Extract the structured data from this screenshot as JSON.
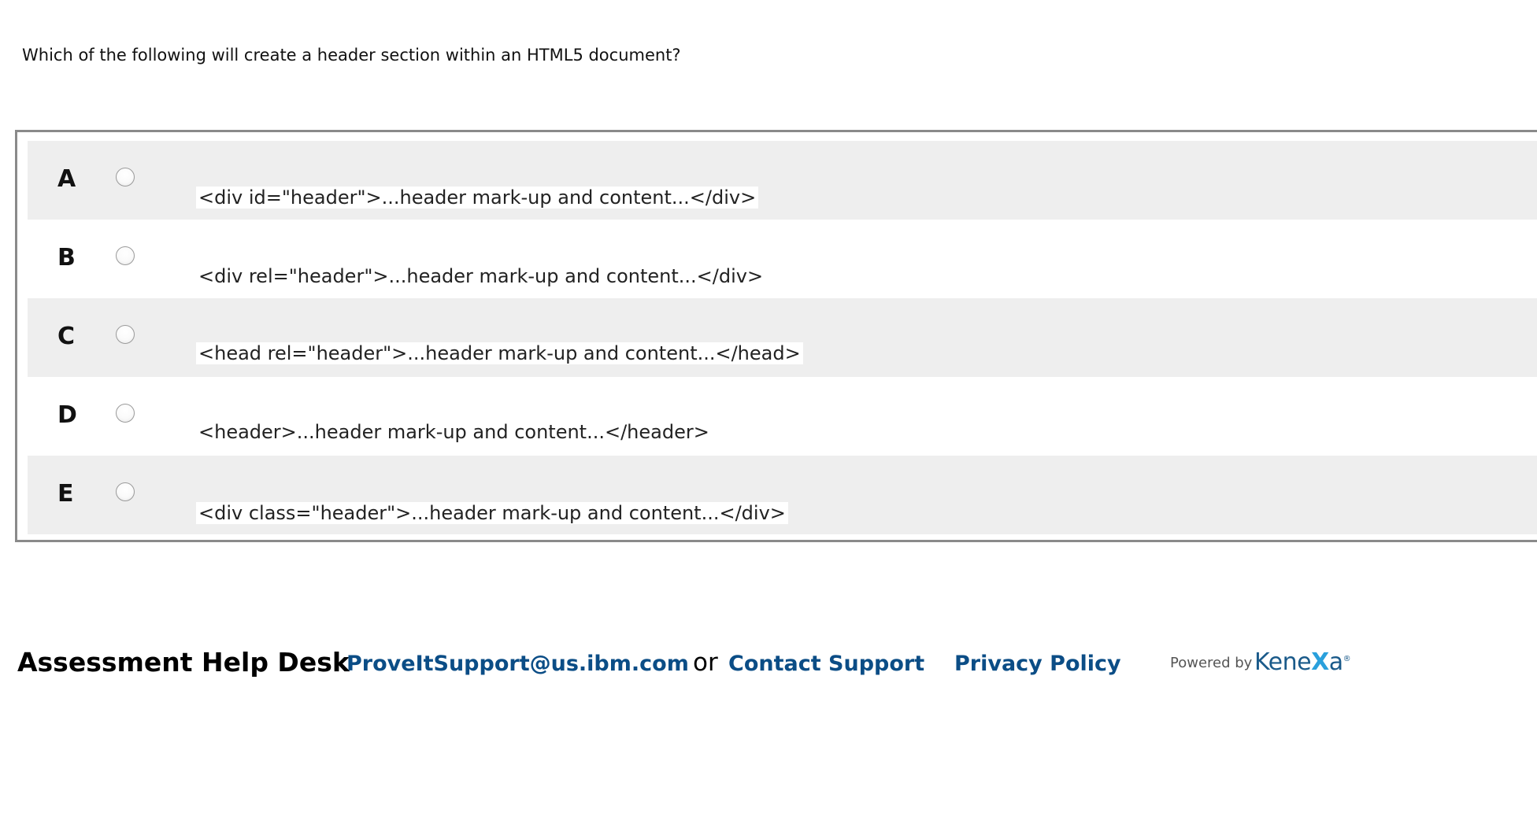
{
  "question": {
    "text": "Which of the following will create a header section within an HTML5 document?"
  },
  "options": [
    {
      "letter": "A",
      "text": "<div id=\"header\">...header mark-up and content...</div>"
    },
    {
      "letter": "B",
      "text": "<div rel=\"header\">...header mark-up and content...</div>"
    },
    {
      "letter": "C",
      "text": "<head rel=\"header\">...header mark-up and content...</head>"
    },
    {
      "letter": "D",
      "text": "<header>...header mark-up and content...</header>"
    },
    {
      "letter": "E",
      "text": "<div class=\"header\">...header mark-up and content...</div>"
    }
  ],
  "footer": {
    "help_desk_label": "Assessment Help Desk",
    "support_email": "ProveItSupport@us.ibm.com",
    "or_text": "or",
    "contact_support": "Contact Support",
    "privacy_policy": "Privacy Policy",
    "powered_by": "Powered by",
    "logo_text_part1": "Kene",
    "logo_text_x": "X",
    "logo_text_part2": "a",
    "logo_reg": "®"
  },
  "colors": {
    "link": "#0b4d86",
    "row_shade": "#eeeeee",
    "border": "#8a8a8a",
    "logo_blue": "#1a5a8a",
    "logo_x": "#2aa0dc"
  }
}
